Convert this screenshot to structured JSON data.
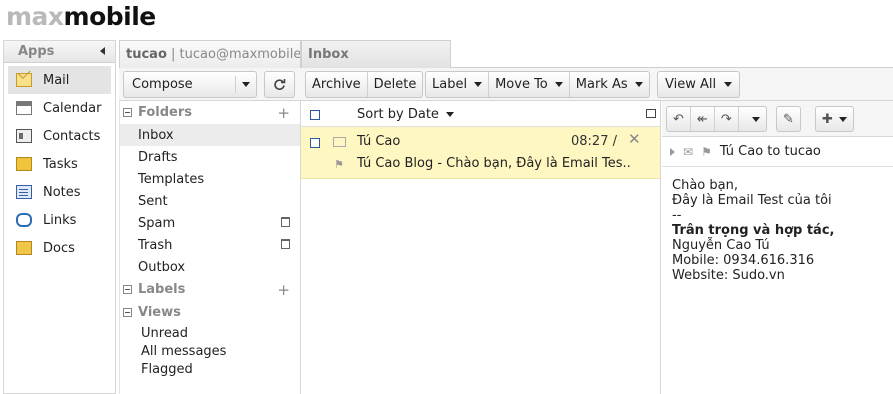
{
  "logo": {
    "part1": "max",
    "part2": "mobile"
  },
  "apps": {
    "title": "Apps",
    "items": [
      {
        "label": "Mail",
        "icon": "mail-icon",
        "selected": true
      },
      {
        "label": "Calendar",
        "icon": "calendar-icon"
      },
      {
        "label": "Contacts",
        "icon": "contacts-icon"
      },
      {
        "label": "Tasks",
        "icon": "tasks-icon"
      },
      {
        "label": "Notes",
        "icon": "notes-icon"
      },
      {
        "label": "Links",
        "icon": "links-icon"
      },
      {
        "label": "Docs",
        "icon": "docs-icon"
      }
    ]
  },
  "tabs": {
    "account_user": "tucao",
    "account_email": " | tucao@maxmobile....",
    "inbox": "Inbox"
  },
  "toolbar": {
    "compose": "Compose",
    "archive": "Archive",
    "delete": "Delete",
    "label": "Label",
    "move_to": "Move To",
    "mark_as": "Mark As",
    "view_all": "View All"
  },
  "folders": {
    "folders_title": "Folders",
    "items": [
      "Inbox",
      "Drafts",
      "Templates",
      "Sent",
      "Spam",
      "Trash",
      "Outbox"
    ],
    "labels_title": "Labels",
    "views_title": "Views",
    "views": [
      "Unread",
      "All messages",
      "Flagged"
    ]
  },
  "message_list": {
    "sort_label": "Sort by Date",
    "messages": [
      {
        "from": "Tú Cao",
        "time": "08:27 /",
        "subject": "Tú Cao Blog - Chào bạn, Đây là Email Tes.."
      }
    ]
  },
  "reader": {
    "header": "Tú Cao to tucao",
    "body": {
      "line1": "Chào bạn,",
      "line2": "Đây là Email Test của tôi",
      "line3": "--",
      "line4": "Trân trọng và hợp tác,",
      "line5": "Nguyễn Cao Tú",
      "line6": "Mobile: 0934.616.316",
      "line7": "Website: Sudo.vn"
    }
  },
  "colors": {
    "selected_message_bg": "#fff7c2",
    "checkbox_blue": "#2c5aa0"
  }
}
